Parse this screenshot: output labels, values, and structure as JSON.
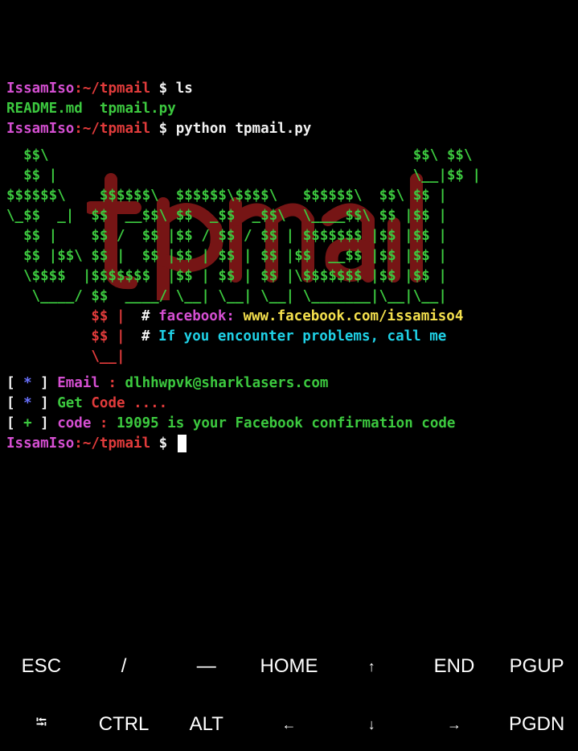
{
  "terminal": {
    "prompt_user": "IssamIso",
    "prompt_path": ":~/tpmail",
    "prompt_symbol": " $ ",
    "cmd1": "ls",
    "ls_output": [
      "README.md",
      "tpmail.py"
    ],
    "cmd2": "python tpmail.py",
    "banner": {
      "lines": [
        "  $$\\                                           $$\\ $$\\",
        "  $$ |                                          \\__|$$ |",
        "$$$$$$\\    $$$$$$\\  $$$$$$\\$$$$\\   $$$$$$\\  $$\\ $$ |",
        "\\_$$  _|  $$  __$$\\ $$  _$$  _$$\\  \\____$$\\ $$ |$$ |",
        "  $$ |    $$ /  $$ |$$ / $$ / $$ | $$$$$$$ |$$ |$$ |",
        "  $$ |$$\\ $$ |  $$ |$$ | $$ | $$ |$$  __$$ |$$ |$$ |",
        "  \\$$$$  |$$$$$$$  |$$ | $$ | $$ |\\$$$$$$$ |$$ |$$ |",
        "   \\____/ $$  ____/ \\__| \\__| \\__| \\_______|\\__|\\__|",
        "          $$ |",
        "          $$ |",
        "          \\__|"
      ],
      "info1_prefix": "# ",
      "info1_label": "facebook:",
      "info1_value": " www.facebook.com/issamiso4",
      "info2_prefix": "# ",
      "info2_text": "If you encounter problems, call me"
    },
    "status": [
      {
        "open": "[ ",
        "mark": "*",
        "close": " ] ",
        "label": "Email",
        "sep": " : ",
        "value": "dlhhwpvk@sharklasers.com"
      },
      {
        "open": "[ ",
        "mark": "*",
        "close": " ] ",
        "label": "Get",
        "sep": " ",
        "value": "Code ...."
      },
      {
        "open": "[ ",
        "mark": "+",
        "close": " ] ",
        "label": "code",
        "sep": " : ",
        "value": "19095 is your Facebook confirmation code"
      }
    ]
  },
  "extra_keys": {
    "row1": [
      "ESC",
      "/",
      "—",
      "HOME",
      "↑",
      "END",
      "PGUP"
    ],
    "row2": [
      "⭾",
      "CTRL",
      "ALT",
      "←",
      "↓",
      "→",
      "PGDN"
    ]
  },
  "colors": {
    "background": "#000000",
    "prompt_user": "#d54fd2",
    "prompt_path": "#e13b3b",
    "ls_output": "#3cc93f",
    "banner_green": "#3cc93f",
    "banner_red": "#e13b3b",
    "link_yellow": "#f4e04d",
    "info_cyan": "#1fd1e6",
    "status_mark": "#6a72ff"
  }
}
